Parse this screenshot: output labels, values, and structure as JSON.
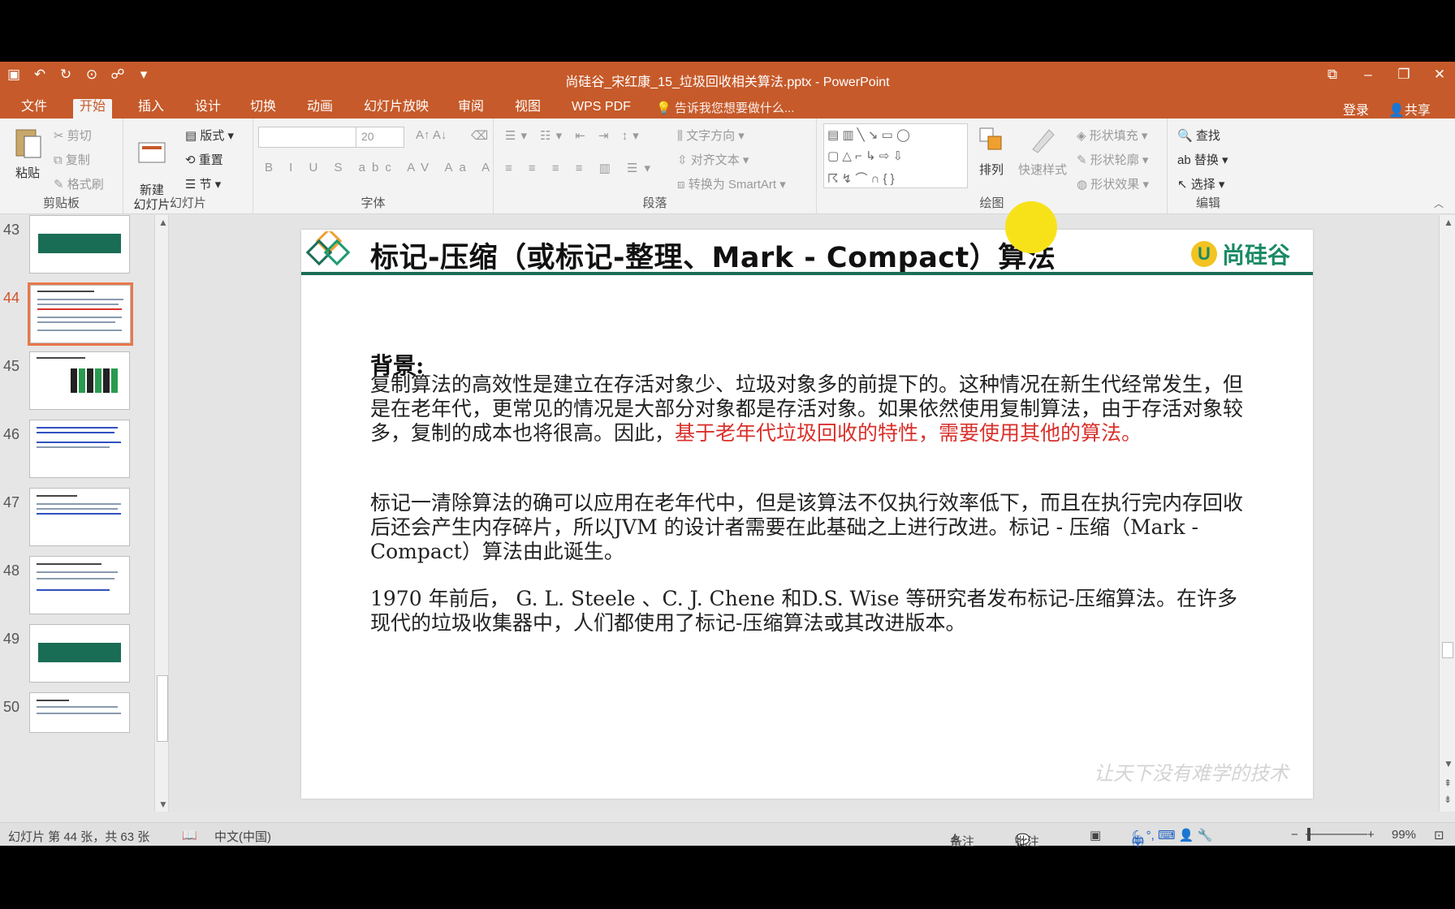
{
  "window": {
    "title": "尚硅谷_宋红康_15_垃圾回收相关算法.pptx - PowerPoint"
  },
  "tabs": {
    "items": [
      "文件",
      "开始",
      "插入",
      "设计",
      "切换",
      "动画",
      "幻灯片放映",
      "审阅",
      "视图",
      "WPS PDF"
    ],
    "active": "开始",
    "tell_me": "告诉我您想要做什么...",
    "login": "登录",
    "share": "共享"
  },
  "ribbon": {
    "clipboard": {
      "paste": "粘贴",
      "cut": "剪切",
      "copy": "复制",
      "format_painter": "格式刷",
      "label": "剪贴板"
    },
    "slides": {
      "new_slide": "新建\n幻灯片",
      "layout": "版式",
      "reset": "重置",
      "section": "节",
      "label": "幻灯片"
    },
    "font": {
      "font_size": "20",
      "label": "字体"
    },
    "paragraph": {
      "text_direction": "文字方向",
      "align_text": "对齐文本",
      "smartart": "转换为 SmartArt",
      "label": "段落"
    },
    "drawing": {
      "arrange": "排列",
      "quick_styles": "快速样式",
      "shape_fill": "形状填充",
      "shape_outline": "形状轮廓",
      "shape_effects": "形状效果",
      "label": "绘图"
    },
    "editing": {
      "find": "查找",
      "replace": "替换",
      "select": "选择",
      "label": "编辑"
    }
  },
  "thumbnails": {
    "numbers": [
      "43",
      "44",
      "45",
      "46",
      "47",
      "48",
      "49",
      "50"
    ],
    "selected": "44"
  },
  "slide": {
    "title": "标记-压缩（或标记-整理、Mark - Compact）算法",
    "brand": "尚硅谷",
    "heading": "背景:",
    "para1_plain": "复制算法的高效性是建立在存活对象少、垃圾对象多的前提下的。这种情况在新生代经常发生，但是在老年代，更常见的情况是大部分对象都是存活对象。如果依然使用复制算法，由于存活对象较多，复制的成本也将很高。因此，",
    "para1_red": "基于老年代垃圾回收的特性，需要使用其他的算法。",
    "para2": "标记一清除算法的确可以应用在老年代中，但是该算法不仅执行效率低下，而且在执行完内存回收后还会产生内存碎片，所以JVM 的设计者需要在此基础之上进行改进。标记 - 压缩（Mark - Compact）算法由此诞生。",
    "para3": "1970 年前后， G. L. Steele 、C. J. Chene 和D.S. Wise 等研究者发布标记-压缩算法。在许多现代的垃圾收集器中，人们都使用了标记-压缩算法或其改进版本。",
    "watermark": "让天下没有难学的技术"
  },
  "status": {
    "slide_info": "幻灯片 第 44 张，共 63 张",
    "language": "中文(中国)",
    "notes": "备注",
    "comments": "批注",
    "ime": "中",
    "zoom": "99%"
  }
}
